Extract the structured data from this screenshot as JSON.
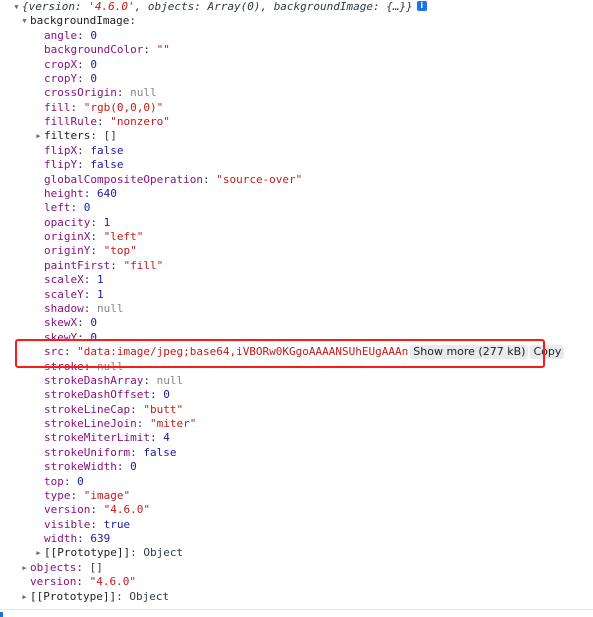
{
  "summary": {
    "open": "{",
    "items": [
      {
        "key": "version",
        "value": "'4.6.0'",
        "type": "str"
      },
      {
        "key": "objects",
        "value": "Array(0)",
        "type": "plain"
      },
      {
        "key": "backgroundImage",
        "value": "{…}",
        "type": "plain"
      }
    ],
    "close": "}",
    "info_icon": "i"
  },
  "backgroundImage": {
    "label": "backgroundImage",
    "properties": [
      {
        "key": "angle",
        "value": "0",
        "type": "num"
      },
      {
        "key": "backgroundColor",
        "value": "\"\"",
        "type": "str"
      },
      {
        "key": "cropX",
        "value": "0",
        "type": "num"
      },
      {
        "key": "cropY",
        "value": "0",
        "type": "num"
      },
      {
        "key": "crossOrigin",
        "value": "null",
        "type": "null"
      },
      {
        "key": "fill",
        "value": "\"rgb(0,0,0)\"",
        "type": "str"
      },
      {
        "key": "fillRule",
        "value": "\"nonzero\"",
        "type": "str"
      },
      {
        "key": "filters",
        "value": "[]",
        "type": "plain",
        "expandable": true
      },
      {
        "key": "flipX",
        "value": "false",
        "type": "bool"
      },
      {
        "key": "flipY",
        "value": "false",
        "type": "bool"
      },
      {
        "key": "globalCompositeOperation",
        "value": "\"source-over\"",
        "type": "str"
      },
      {
        "key": "height",
        "value": "640",
        "type": "num"
      },
      {
        "key": "left",
        "value": "0",
        "type": "num"
      },
      {
        "key": "opacity",
        "value": "1",
        "type": "num"
      },
      {
        "key": "originX",
        "value": "\"left\"",
        "type": "str"
      },
      {
        "key": "originY",
        "value": "\"top\"",
        "type": "str"
      },
      {
        "key": "paintFirst",
        "value": "\"fill\"",
        "type": "str"
      },
      {
        "key": "scaleX",
        "value": "1",
        "type": "num"
      },
      {
        "key": "scaleY",
        "value": "1",
        "type": "num"
      },
      {
        "key": "shadow",
        "value": "null",
        "type": "null"
      },
      {
        "key": "skewX",
        "value": "0",
        "type": "num"
      },
      {
        "key": "skewY",
        "value": "0",
        "type": "num"
      },
      {
        "key": "src",
        "value": "\"data:image/jpeg;base64,iVBORw0KGgoAAAANSUhEUgAAAn",
        "type": "str",
        "show_more": "Show more (277 kB)",
        "copy": "Copy"
      },
      {
        "key": "stroke",
        "value": "null",
        "type": "null"
      },
      {
        "key": "strokeDashArray",
        "value": "null",
        "type": "null"
      },
      {
        "key": "strokeDashOffset",
        "value": "0",
        "type": "num"
      },
      {
        "key": "strokeLineCap",
        "value": "\"butt\"",
        "type": "str"
      },
      {
        "key": "strokeLineJoin",
        "value": "\"miter\"",
        "type": "str"
      },
      {
        "key": "strokeMiterLimit",
        "value": "4",
        "type": "num"
      },
      {
        "key": "strokeUniform",
        "value": "false",
        "type": "bool"
      },
      {
        "key": "strokeWidth",
        "value": "0",
        "type": "num"
      },
      {
        "key": "top",
        "value": "0",
        "type": "num"
      },
      {
        "key": "type",
        "value": "\"image\"",
        "type": "str"
      },
      {
        "key": "version",
        "value": "\"4.6.0\"",
        "type": "str"
      },
      {
        "key": "visible",
        "value": "true",
        "type": "bool"
      },
      {
        "key": "width",
        "value": "639",
        "type": "num"
      }
    ],
    "prototype": {
      "key": "[[Prototype]]",
      "value": "Object"
    }
  },
  "root_tail": [
    {
      "key": "objects",
      "value": "[]",
      "type": "plain",
      "expandable": true
    },
    {
      "key": "version",
      "value": "\"4.6.0\"",
      "type": "str"
    },
    {
      "key": "[[Prototype]]",
      "value": "Object",
      "type": "plain",
      "expandable": true,
      "plain_key": true
    }
  ],
  "highlight": {
    "color": "#ff1a1a",
    "target_property": "src"
  }
}
